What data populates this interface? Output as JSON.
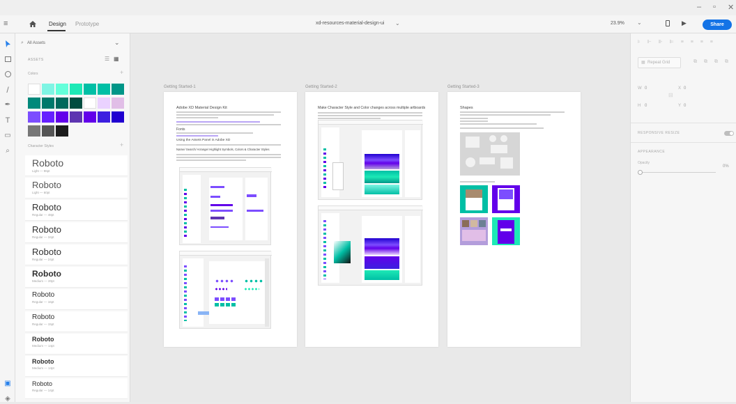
{
  "window": {
    "minimize": "–",
    "maximize": "▫",
    "close": "✕"
  },
  "topbar": {
    "design_tab": "Design",
    "prototype_tab": "Prototype",
    "doc_title": "xd-resources-material-design-ui",
    "zoom": "23.9%",
    "share": "Share"
  },
  "assets": {
    "search_placeholder": "All Assets",
    "section": "ASSETS",
    "colors_label": "Colors",
    "char_styles_label": "Character Styles",
    "colors": [
      [
        "#ffffff",
        "#7ff5e4",
        "#64ffda",
        "#1de9b6",
        "#00bfa5",
        "#00bfa5",
        "#009688"
      ],
      [
        "#00897b",
        "#00796b",
        "#00695c",
        "#004d40",
        "#ffffff",
        "#ead2ff",
        "#e1bee7"
      ],
      [
        "#7c4dff",
        "#651fff",
        "#6200ea",
        "#5e35b1",
        "#6200ea",
        "#3d1fe0",
        "#2000d0"
      ],
      [
        "#777777",
        "#555555",
        "#1d1d1d"
      ]
    ],
    "char_styles": [
      {
        "name": "Roboto",
        "meta": "Light — 96pt",
        "size": 14,
        "weight": 300
      },
      {
        "name": "Roboto",
        "meta": "Light — 60pt",
        "size": 13,
        "weight": 300
      },
      {
        "name": "Roboto",
        "meta": "Regular — 48pt",
        "size": 13,
        "weight": 400
      },
      {
        "name": "Roboto",
        "meta": "Regular — 34pt",
        "size": 13,
        "weight": 400
      },
      {
        "name": "Roboto",
        "meta": "Regular — 24pt",
        "size": 13,
        "weight": 400
      },
      {
        "name": "Roboto",
        "meta": "Medium — 20pt",
        "size": 12,
        "weight": 700
      },
      {
        "name": "Roboto",
        "meta": "Regular — 16pt",
        "size": 10,
        "weight": 400
      },
      {
        "name": "Roboto",
        "meta": "Regular — 15pt",
        "size": 10,
        "weight": 400
      },
      {
        "name": "Roboto",
        "meta": "Medium — 14pt",
        "size": 9,
        "weight": 700
      },
      {
        "name": "Roboto",
        "meta": "Medium — 14pt",
        "size": 9,
        "weight": 700
      },
      {
        "name": "Roboto",
        "meta": "Regular — 14pt",
        "size": 9,
        "weight": 400
      }
    ]
  },
  "artboards": [
    {
      "label": "Getting Started-1",
      "heading": "Adobe XD Material Design Kit",
      "h2": "Fonts",
      "h3": "Using the Assets Panel in Adobe XD",
      "h4": "Name/ Search/ Arrange/ Highlight Symbols, Colors & Character Styles"
    },
    {
      "label": "Getting Started-2",
      "heading": "Make Character Style and Color changes across multiple artboards"
    },
    {
      "label": "Getting Started-3",
      "heading": "Shapes"
    }
  ],
  "props": {
    "repeat_grid": "Repeat Grid",
    "w_label": "W",
    "w_value": "0",
    "x_label": "X",
    "x_value": "0",
    "h_label": "H",
    "h_value": "0",
    "y_label": "Y",
    "y_value": "0",
    "responsive_resize": "RESPONSIVE RESIZE",
    "appearance": "APPEARANCE",
    "opacity_label": "Opacity",
    "opacity_value": "0%"
  }
}
